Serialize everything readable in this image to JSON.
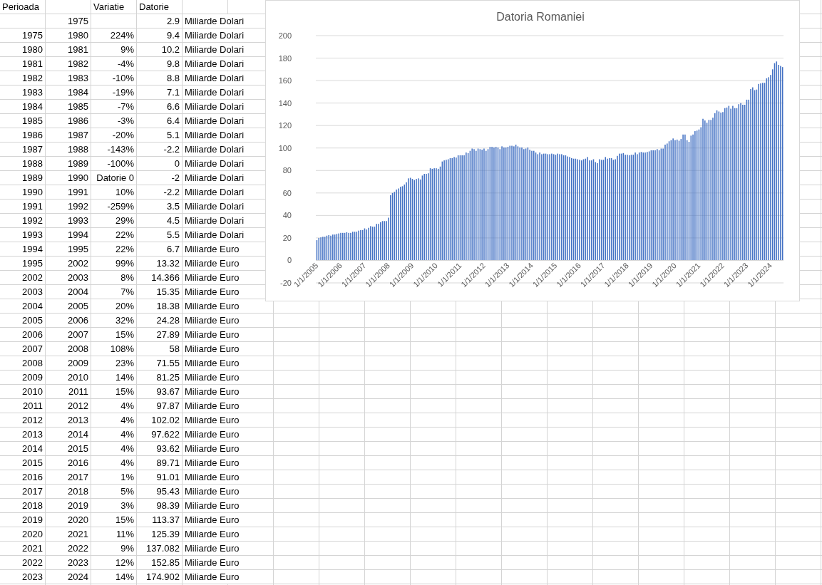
{
  "sheet": {
    "headers": {
      "period": "Perioada",
      "variation": "Variatie",
      "debt": "Datorie"
    },
    "rows": [
      {
        "end": "1975",
        "debt": "2.9",
        "unit": "Miliarde Dolari"
      },
      {
        "start": "1975",
        "end": "1980",
        "variation": "224%",
        "debt": "9.4",
        "unit": "Miliarde Dolari"
      },
      {
        "start": "1980",
        "end": "1981",
        "variation": "9%",
        "debt": "10.2",
        "unit": "Miliarde Dolari"
      },
      {
        "start": "1981",
        "end": "1982",
        "variation": "-4%",
        "debt": "9.8",
        "unit": "Miliarde Dolari"
      },
      {
        "start": "1982",
        "end": "1983",
        "variation": "-10%",
        "debt": "8.8",
        "unit": "Miliarde Dolari"
      },
      {
        "start": "1983",
        "end": "1984",
        "variation": "-19%",
        "debt": "7.1",
        "unit": "Miliarde Dolari"
      },
      {
        "start": "1984",
        "end": "1985",
        "variation": "-7%",
        "debt": "6.6",
        "unit": "Miliarde Dolari"
      },
      {
        "start": "1985",
        "end": "1986",
        "variation": "-3%",
        "debt": "6.4",
        "unit": "Miliarde Dolari"
      },
      {
        "start": "1986",
        "end": "1987",
        "variation": "-20%",
        "debt": "5.1",
        "unit": "Miliarde Dolari"
      },
      {
        "start": "1987",
        "end": "1988",
        "variation": "-143%",
        "debt": "-2.2",
        "unit": "Miliarde Dolari"
      },
      {
        "start": "1988",
        "end": "1989",
        "variation": "-100%",
        "debt": "0",
        "unit": "Miliarde Dolari"
      },
      {
        "start": "1989",
        "end": "1990",
        "variation": "Datorie 0",
        "debt": "-2",
        "unit": "Miliarde Dolari"
      },
      {
        "start": "1990",
        "end": "1991",
        "variation": "10%",
        "debt": "-2.2",
        "unit": "Miliarde Dolari"
      },
      {
        "start": "1991",
        "end": "1992",
        "variation": "-259%",
        "debt": "3.5",
        "unit": "Miliarde Dolari"
      },
      {
        "start": "1992",
        "end": "1993",
        "variation": "29%",
        "debt": "4.5",
        "unit": "Miliarde Dolari"
      },
      {
        "start": "1993",
        "end": "1994",
        "variation": "22%",
        "debt": "5.5",
        "unit": "Miliarde Dolari"
      },
      {
        "start": "1994",
        "end": "1995",
        "variation": "22%",
        "debt": "6.7",
        "unit": "Miliarde Euro"
      },
      {
        "start": "1995",
        "end": "2002",
        "variation": "99%",
        "debt": "13.32",
        "unit": "Miliarde Euro"
      },
      {
        "start": "2002",
        "end": "2003",
        "variation": "8%",
        "debt": "14.366",
        "unit": "Miliarde Euro"
      },
      {
        "start": "2003",
        "end": "2004",
        "variation": "7%",
        "debt": "15.35",
        "unit": "Miliarde Euro"
      },
      {
        "start": "2004",
        "end": "2005",
        "variation": "20%",
        "debt": "18.38",
        "unit": "Miliarde Euro"
      },
      {
        "start": "2005",
        "end": "2006",
        "variation": "32%",
        "debt": "24.28",
        "unit": "Miliarde Euro"
      },
      {
        "start": "2006",
        "end": "2007",
        "variation": "15%",
        "debt": "27.89",
        "unit": "Miliarde Euro"
      },
      {
        "start": "2007",
        "end": "2008",
        "variation": "108%",
        "debt": "58",
        "unit": "Miliarde Euro"
      },
      {
        "start": "2008",
        "end": "2009",
        "variation": "23%",
        "debt": "71.55",
        "unit": "Miliarde Euro"
      },
      {
        "start": "2009",
        "end": "2010",
        "variation": "14%",
        "debt": "81.25",
        "unit": "Miliarde Euro"
      },
      {
        "start": "2010",
        "end": "2011",
        "variation": "15%",
        "debt": "93.67",
        "unit": "Miliarde Euro"
      },
      {
        "start": "2011",
        "end": "2012",
        "variation": "4%",
        "debt": "97.87",
        "unit": "Miliarde Euro"
      },
      {
        "start": "2012",
        "end": "2013",
        "variation": "4%",
        "debt": "102.02",
        "unit": "Miliarde Euro"
      },
      {
        "start": "2013",
        "end": "2014",
        "variation": "4%",
        "debt": "97.622",
        "unit": "Miliarde Euro"
      },
      {
        "start": "2014",
        "end": "2015",
        "variation": "4%",
        "debt": "93.62",
        "unit": "Miliarde Euro"
      },
      {
        "start": "2015",
        "end": "2016",
        "variation": "4%",
        "debt": "89.71",
        "unit": "Miliarde Euro"
      },
      {
        "start": "2016",
        "end": "2017",
        "variation": "1%",
        "debt": "91.01",
        "unit": "Miliarde Euro"
      },
      {
        "start": "2017",
        "end": "2018",
        "variation": "5%",
        "debt": "95.43",
        "unit": "Miliarde Euro"
      },
      {
        "start": "2018",
        "end": "2019",
        "variation": "3%",
        "debt": "98.39",
        "unit": "Miliarde Euro"
      },
      {
        "start": "2019",
        "end": "2020",
        "variation": "15%",
        "debt": "113.37",
        "unit": "Miliarde Euro"
      },
      {
        "start": "2020",
        "end": "2021",
        "variation": "11%",
        "debt": "125.39",
        "unit": "Miliarde Euro"
      },
      {
        "start": "2021",
        "end": "2022",
        "variation": "9%",
        "debt": "137.082",
        "unit": "Miliarde Euro"
      },
      {
        "start": "2022",
        "end": "2023",
        "variation": "12%",
        "debt": "152.85",
        "unit": "Miliarde Euro"
      },
      {
        "start": "2023",
        "end": "2024",
        "variation": "14%",
        "debt": "174.902",
        "unit": "Miliarde Euro"
      }
    ]
  },
  "chart": {
    "chart_data": {
      "type": "bar",
      "title": "Datoria Romaniei",
      "grid": true,
      "ylim": [
        -20,
        200
      ],
      "yticks": [
        -20,
        0,
        20,
        40,
        60,
        80,
        100,
        120,
        140,
        160,
        180,
        200
      ],
      "categories": [
        "1/1/2005",
        null,
        null,
        null,
        null,
        null,
        null,
        null,
        null,
        null,
        null,
        null,
        "1/1/2006",
        null,
        null,
        null,
        null,
        null,
        null,
        null,
        null,
        null,
        null,
        null,
        "1/1/2007",
        null,
        null,
        null,
        null,
        null,
        null,
        null,
        null,
        null,
        null,
        null,
        "1/1/2008",
        null,
        null,
        null,
        null,
        null,
        null,
        null,
        null,
        null,
        null,
        null,
        "1/1/2009",
        null,
        null,
        null,
        null,
        null,
        null,
        null,
        null,
        null,
        null,
        null,
        "1/1/2010",
        null,
        null,
        null,
        null,
        null,
        null,
        null,
        null,
        null,
        null,
        null,
        "1/1/2011",
        null,
        null,
        null,
        null,
        null,
        null,
        null,
        null,
        null,
        null,
        null,
        "1/1/2012",
        null,
        null,
        null,
        null,
        null,
        null,
        null,
        null,
        null,
        null,
        null,
        "1/1/2013",
        null,
        null,
        null,
        null,
        null,
        null,
        null,
        null,
        null,
        null,
        null,
        "1/1/2014",
        null,
        null,
        null,
        null,
        null,
        null,
        null,
        null,
        null,
        null,
        null,
        "1/1/2015",
        null,
        null,
        null,
        null,
        null,
        null,
        null,
        null,
        null,
        null,
        null,
        "1/1/2016",
        null,
        null,
        null,
        null,
        null,
        null,
        null,
        null,
        null,
        null,
        null,
        "1/1/2017",
        null,
        null,
        null,
        null,
        null,
        null,
        null,
        null,
        null,
        null,
        null,
        "1/1/2018",
        null,
        null,
        null,
        null,
        null,
        null,
        null,
        null,
        null,
        null,
        null,
        "1/1/2019",
        null,
        null,
        null,
        null,
        null,
        null,
        null,
        null,
        null,
        null,
        null,
        "1/1/2020",
        null,
        null,
        null,
        null,
        null,
        null,
        null,
        null,
        null,
        null,
        null,
        "1/1/2021",
        null,
        null,
        null,
        null,
        null,
        null,
        null,
        null,
        null,
        null,
        null,
        "1/1/2022",
        null,
        null,
        null,
        null,
        null,
        null,
        null,
        null,
        null,
        null,
        null,
        "1/1/2023",
        null,
        null,
        null,
        null,
        null,
        null,
        null,
        null,
        null,
        null,
        null,
        "1/1/2024",
        null,
        null,
        null,
        null,
        null,
        null
      ],
      "series": [
        {
          "color": "#4472c4",
          "values": [
            18,
            20,
            20.5,
            21,
            21,
            22,
            22.5,
            22,
            23,
            23,
            23.5,
            24,
            24.5,
            24.5,
            24.5,
            25,
            24.5,
            24.5,
            25.5,
            25.5,
            25.5,
            26.5,
            27,
            27,
            28.5,
            27.5,
            29,
            30.5,
            30,
            30,
            32.5,
            32.5,
            34,
            35,
            35,
            35,
            38,
            58,
            60,
            61,
            63,
            64,
            65.5,
            66,
            67.5,
            69.5,
            73,
            73.5,
            72.5,
            71.5,
            72.5,
            73,
            72,
            75.5,
            77,
            77,
            77.5,
            82,
            81.5,
            82,
            82,
            81.5,
            83.5,
            88,
            89,
            89.5,
            90,
            91,
            91,
            92,
            91.5,
            93.5,
            93.5,
            93.5,
            93.5,
            96,
            95.5,
            97.5,
            99.5,
            99,
            97.5,
            99.5,
            99,
            98.5,
            99.5,
            97.5,
            99,
            101,
            101,
            100.5,
            101,
            100.5,
            99,
            101.5,
            100.5,
            100.5,
            101,
            102,
            102,
            101.5,
            103,
            101.5,
            100.5,
            100.5,
            99,
            99.5,
            100.5,
            98.5,
            97.5,
            97.5,
            96,
            94.5,
            96,
            94.5,
            95,
            95,
            94.5,
            94.5,
            95,
            94.5,
            94,
            95,
            94.5,
            94.5,
            93.5,
            93.5,
            92.5,
            92,
            91,
            90.5,
            90.5,
            90,
            89.5,
            89,
            90,
            90.5,
            92,
            89,
            89,
            90,
            87.5,
            86.5,
            90,
            89.5,
            89.5,
            92,
            90.5,
            91,
            91,
            89.5,
            90,
            93,
            95,
            95,
            95.5,
            94,
            94,
            93.5,
            94,
            94,
            96,
            94.5,
            96,
            96.5,
            96,
            96,
            96.5,
            97,
            98,
            98,
            98,
            99,
            98,
            99.5,
            99.5,
            103,
            104,
            106,
            107,
            108.5,
            107,
            107.5,
            106.5,
            108,
            112,
            112,
            107,
            105.5,
            111,
            112,
            115,
            115.5,
            116.5,
            118.5,
            126,
            124.5,
            122.5,
            125,
            125,
            127,
            131,
            133.5,
            132.5,
            131.5,
            132,
            135.5,
            136,
            137.5,
            135,
            137.5,
            135.5,
            135.5,
            139,
            140,
            138.5,
            138.5,
            143,
            143,
            152.5,
            154,
            151.5,
            152,
            157,
            157.5,
            158,
            158,
            162,
            163,
            165,
            170,
            175.5,
            177,
            174,
            173,
            172
          ]
        }
      ]
    }
  }
}
